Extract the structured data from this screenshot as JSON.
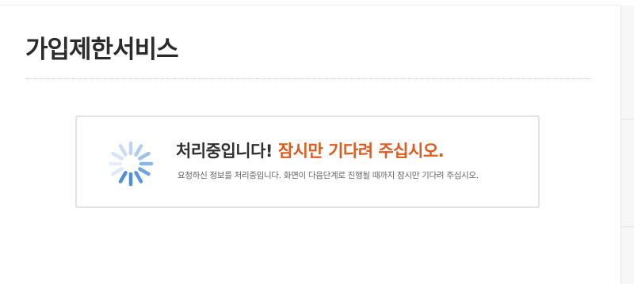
{
  "page": {
    "title": "가입제한서비스"
  },
  "notice": {
    "headline_main": "처리중입니다!",
    "headline_accent": "잠시만 기다려 주십시오.",
    "description": "요청하신 정보를 처리중입니다. 화면이 다음단계로 진행될 때까지 잠시만 기다려 주십시오.",
    "spinner_icon": "loading-spinner-icon"
  },
  "colors": {
    "accent": "#e05a1e",
    "spinner_blue": "#4a8fd8",
    "title_text": "#2b2b2b",
    "body_text": "#666666",
    "box_border": "#e3e3e3"
  }
}
